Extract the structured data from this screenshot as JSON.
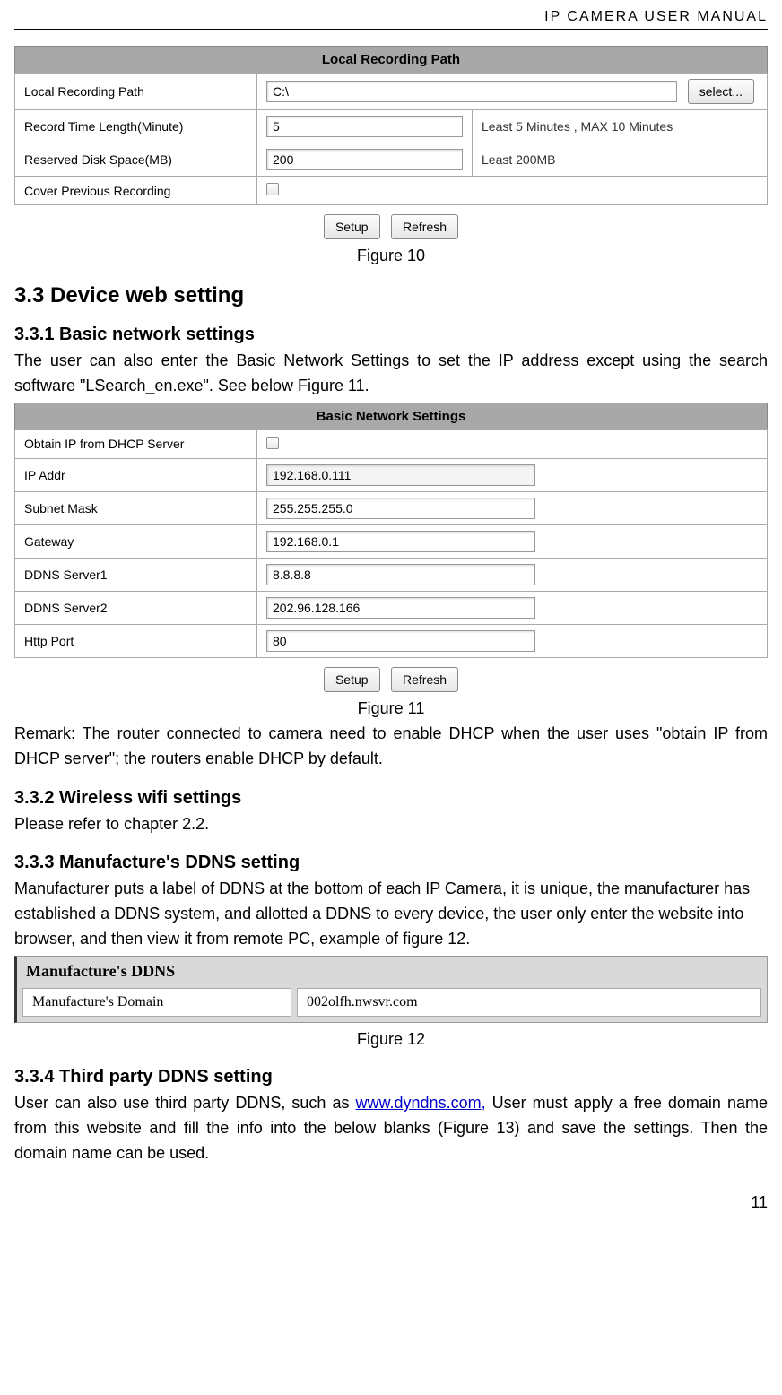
{
  "header": {
    "title": "IP CAMERA USER MANUAL",
    "page_number": "11"
  },
  "figure10": {
    "title": "Local Recording Path",
    "rows": {
      "path_label": "Local Recording Path",
      "path_value": "C:\\",
      "select_btn": "select...",
      "time_label": "Record Time Length(Minute)",
      "time_value": "5",
      "time_note": "Least 5 Minutes , MAX 10 Minutes",
      "disk_label": "Reserved Disk Space(MB)",
      "disk_value": "200",
      "disk_note": "Least 200MB",
      "cover_label": "Cover Previous Recording"
    },
    "setup_btn": "Setup",
    "refresh_btn": "Refresh",
    "caption": "Figure 10"
  },
  "section33": {
    "heading": "3.3 Device web setting",
    "s331": {
      "heading": "3.3.1   Basic network settings",
      "para": "The user can also enter the Basic Network Settings to set the IP address except using the search software \"LSearch_en.exe\". See below Figure 11."
    },
    "figure11": {
      "title": "Basic Network Settings",
      "dhcp_label": "Obtain IP from DHCP Server",
      "ip_label": "IP Addr",
      "ip_value": "192.168.0.111",
      "subnet_label": "Subnet Mask",
      "subnet_value": "255.255.255.0",
      "gateway_label": "Gateway",
      "gateway_value": "192.168.0.1",
      "dns1_label": "DDNS Server1",
      "dns1_value": "8.8.8.8",
      "dns2_label": "DDNS Server2",
      "dns2_value": "202.96.128.166",
      "port_label": "Http Port",
      "port_value": "80",
      "setup_btn": "Setup",
      "refresh_btn": "Refresh",
      "caption": "Figure 11"
    },
    "remark": "Remark: The router connected to camera need to enable DHCP when the user uses \"obtain IP from DHCP server\"; the routers enable DHCP by default.",
    "s332": {
      "heading": "3.3.2   Wireless wifi settings",
      "para": "Please refer to chapter 2.2."
    },
    "s333": {
      "heading": "3.3.3   Manufacture's DDNS setting",
      "para": "Manufacturer puts a label of DDNS at the bottom of each IP Camera, it is unique, the manufacturer has established a DDNS system, and allotted a DDNS to every device, the user only enter the website into browser, and then view it from remote PC, example of figure 12."
    },
    "figure12": {
      "title": "Manufacture's DDNS",
      "domain_label": "Manufacture's Domain",
      "domain_value": "002olfh.nwsvr.com",
      "caption": "Figure 12"
    },
    "s334": {
      "heading": "3.3.4   Third party DDNS setting",
      "para_before": "User can also use third party DDNS, such as ",
      "link_text": "www.dyndns.com,",
      "para_after": " User must apply a free domain name from this website and fill the info into the below blanks (Figure 13) and save the settings. Then the domain name can be used."
    }
  }
}
